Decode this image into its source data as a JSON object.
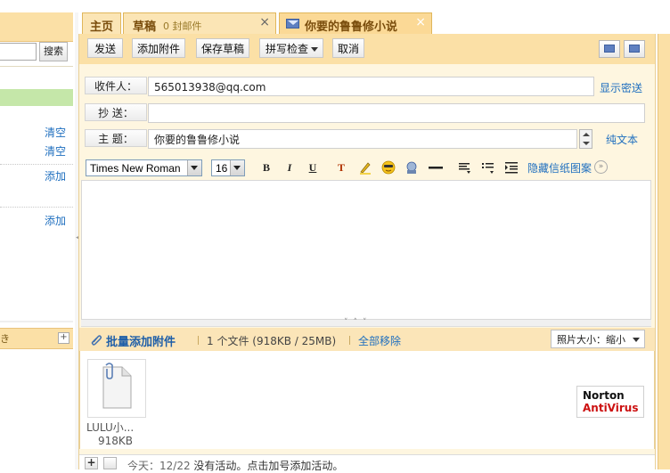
{
  "left_panel": {
    "search_button": "搜索",
    "links": [
      "清空",
      "清空",
      "添加",
      "添加"
    ],
    "bottom_header_cut": "き"
  },
  "tabs": [
    {
      "label": "主页"
    },
    {
      "label": "草稿",
      "sub": "0 封邮件",
      "close": "×"
    },
    {
      "label": "你要的鲁鲁修小说",
      "close": "×",
      "icon": "mail-icon"
    }
  ],
  "toolbar": {
    "send": "发送",
    "add_attachment": "添加附件",
    "save_draft": "保存草稿",
    "spell_check": "拼写检查",
    "cancel": "取消"
  },
  "form": {
    "to_label": "收件人：",
    "to_value": "565013938@qq.com",
    "cc_label": "抄 送：",
    "cc_value": "",
    "subject_label": "主 题：",
    "subject_value": "你要的鲁鲁修小说",
    "show_bcc": "显示密送",
    "plain_text": "纯文本"
  },
  "format_bar": {
    "font_family": "Times New Roman",
    "font_size": "16",
    "bold": "B",
    "italic": "I",
    "underline": "U",
    "font_color": "T",
    "hide_stationery": "隐藏信纸图案"
  },
  "attachments": {
    "batch_add": "批量添加附件",
    "count_info": "1 个文件  (918KB / 25MB)",
    "remove_all": "全部移除",
    "photo_size": "照片大小：缩小",
    "files": [
      {
        "name": "LULU小...",
        "size": "918KB"
      }
    ]
  },
  "antivirus": {
    "line1": "Norton",
    "line2": "AntiVirus"
  },
  "status_bar": {
    "plus": "+",
    "date_prefix": "今天：12/22",
    "message": "没有活动。点击加号添加活动。"
  },
  "colors": {
    "tab_bg": "#fbe5b5",
    "toolbar_bg": "#fbe0a6",
    "link": "#1f6fbf",
    "norton_red": "#cc1111"
  }
}
